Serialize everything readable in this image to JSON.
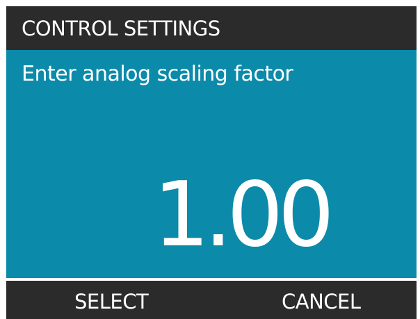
{
  "header": {
    "title": "CONTROL SETTINGS"
  },
  "main": {
    "prompt": "Enter analog scaling factor",
    "value": "1.00"
  },
  "softkeys": {
    "left_label": "SELECT",
    "right_label": "CANCEL"
  },
  "colors": {
    "frame": "#2b2b2b",
    "panel": "#0c8aa9",
    "text": "#ffffff"
  }
}
